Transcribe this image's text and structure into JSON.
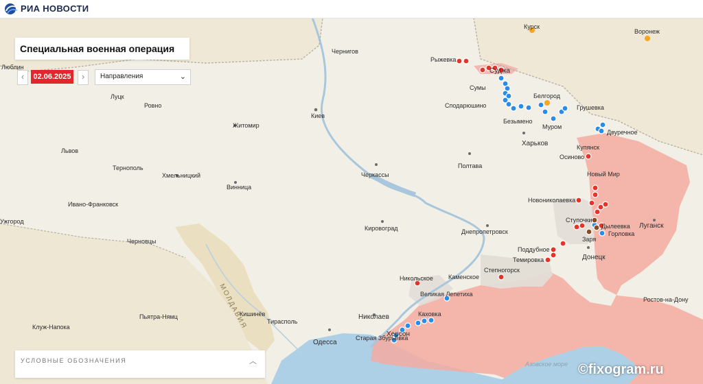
{
  "header": {
    "logo_text": "РИА НОВОСТИ"
  },
  "panel": {
    "title": "Специальная военная операция",
    "date": "02.06.2025",
    "prev_symbol": "‹",
    "next_symbol": "›",
    "directions_select": "Направления"
  },
  "legend": {
    "label": "УСЛОВНЫЕ ОБОЗНАЧЕНИЯ"
  },
  "watermark": "©fixogram.ru",
  "map": {
    "water_labels": {
      "sea_of_azov": "Азовское море"
    },
    "country_labels": {
      "moldova": "МОЛДАВИЯ"
    },
    "cities": {
      "kursk": "Курск",
      "voronezh": "Воронеж",
      "lublin": "Люблин",
      "chernigov": "Чернигов",
      "ryzhevka": "Рыжевка",
      "sudzha": "Суджа",
      "sumy": "Сумы",
      "belgorod": "Белгород",
      "lutsk": "Луцк",
      "rovno": "Ровно",
      "kiev": "Киев",
      "spodaryushino": "Сподарюшино",
      "grushevka": "Грушевка",
      "zhitomir": "Житомир",
      "bezymeno": "Безымено",
      "murom": "Муром",
      "dvurechnoe": "Двуречное",
      "lvov": "Львов",
      "kharkov": "Харьков",
      "kupyansk": "Купянск",
      "osinovo": "Осиново",
      "ternopol": "Тернополь",
      "khmelnitsky": "Хмельницкий",
      "cherkassy": "Черкассы",
      "poltava": "Полтава",
      "novy_mir": "Новый Мир",
      "vinnitsa": "Винница",
      "novonikolaevka": "Новониколаевка",
      "ivano_frankovsk": "Ивано-Франковск",
      "uzhgorod": "Ужгород",
      "stupochki": "Ступочки",
      "kirovograd": "Кировоград",
      "dyleevka": "Дылеевка",
      "lugansk": "Луганск",
      "dnepropetrovsk": "Днепропетровск",
      "chernovtsy": "Черновцы",
      "zarya": "Заря",
      "gorlovka": "Горловка",
      "poddubnoe": "Поддубное",
      "temirovka": "Темировка",
      "donetsk": "Донецк",
      "stepnogorsk": "Степногорск",
      "nikolskoe": "Никольское",
      "kamenskoe": "Каменское",
      "velikaya_lepetikha": "Великая Лепетиха",
      "rostov": "Ростов-на-Дону",
      "kishinev": "Кишинёв",
      "pyatra_nyamts": "Пьятра-Нямц",
      "nikolaev": "Николаев",
      "kakhovka": "Каховка",
      "tiraspol": "Тирасполь",
      "kluzh_napoka": "Клуж-Напока",
      "staraya_zburyevka": "Старая Збурьевка",
      "kherson": "Херсон",
      "odessa": "Одесса"
    }
  },
  "colors": {
    "brand_red": "#e3262d",
    "occupied_fill": "#f4aaa0",
    "contested_fill": "#e2ddd6",
    "water": "#aed0e6",
    "marker_red": "#e5352b",
    "marker_blue": "#2b8ce8",
    "marker_orange": "#f5a623",
    "marker_brown": "#8b4a23"
  }
}
